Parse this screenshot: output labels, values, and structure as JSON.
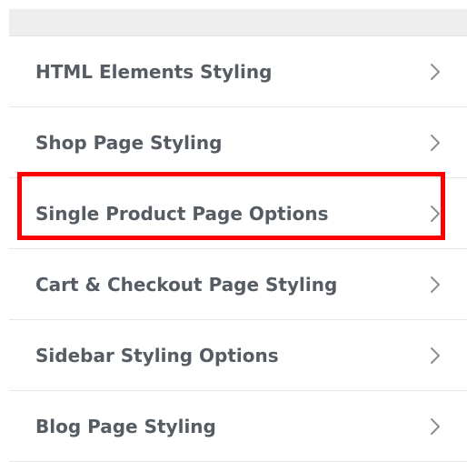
{
  "menu": {
    "items": [
      {
        "label": "HTML Elements Styling",
        "icon": "chevron-right-icon"
      },
      {
        "label": "Shop Page Styling",
        "icon": "chevron-right-icon"
      },
      {
        "label": "Single Product Page Options",
        "icon": "chevron-right-icon",
        "highlighted": true
      },
      {
        "label": "Cart & Checkout Page Styling",
        "icon": "chevron-right-icon"
      },
      {
        "label": "Sidebar Styling Options",
        "icon": "chevron-right-icon"
      },
      {
        "label": "Blog Page Styling",
        "icon": "chevron-right-icon"
      }
    ]
  },
  "colors": {
    "text": "#555c63",
    "chevron": "#8a8f94",
    "divider": "#e6e6e6",
    "top_bar": "#eeeeee",
    "highlight": "#ff0000"
  }
}
